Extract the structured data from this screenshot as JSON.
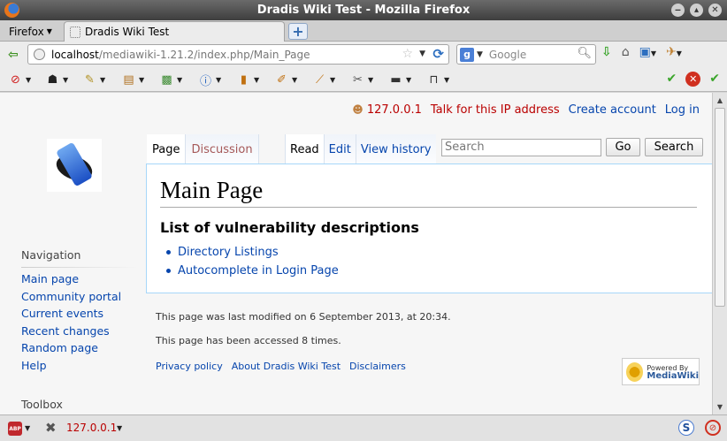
{
  "window": {
    "title": "Dradis Wiki Test - Mozilla Firefox"
  },
  "browser": {
    "menu_label": "Firefox",
    "tab_title": "Dradis Wiki Test",
    "new_tab_symbol": "+",
    "url_host": "localhost",
    "url_path": "/mediawiki-1.21.2/index.php/Main_Page",
    "search_engine": "Google",
    "search_placeholder": "Google"
  },
  "statusbar": {
    "abp_label": "ABP",
    "ip": "127.0.0.1"
  },
  "wiki": {
    "personal": {
      "ip": "127.0.0.1",
      "talk": "Talk for this IP address",
      "create_account": "Create account",
      "login": "Log in"
    },
    "tabs": {
      "page": "Page",
      "discussion": "Discussion",
      "read": "Read",
      "edit": "Edit",
      "history": "View history"
    },
    "search": {
      "placeholder": "Search",
      "go": "Go",
      "search_button": "Search"
    },
    "navigation": {
      "heading": "Navigation",
      "items": [
        "Main page",
        "Community portal",
        "Current events",
        "Recent changes",
        "Random page",
        "Help"
      ]
    },
    "toolbox_heading": "Toolbox",
    "page": {
      "title": "Main Page",
      "section": "List of vulnerability descriptions",
      "links": [
        "Directory Listings",
        "Autocomplete in Login Page"
      ]
    },
    "footer": {
      "last_modified": "This page was last modified on 6 September 2013, at 20:34.",
      "accessed": "This page has been accessed 8 times.",
      "links": [
        "Privacy policy",
        "About Dradis Wiki Test",
        "Disclaimers"
      ],
      "badge_small": "Powered By",
      "badge_big": "MediaWiki"
    }
  },
  "colors": {
    "link": "#0645ad",
    "new_link": "#ba0000",
    "border": "#a7d7f9"
  }
}
